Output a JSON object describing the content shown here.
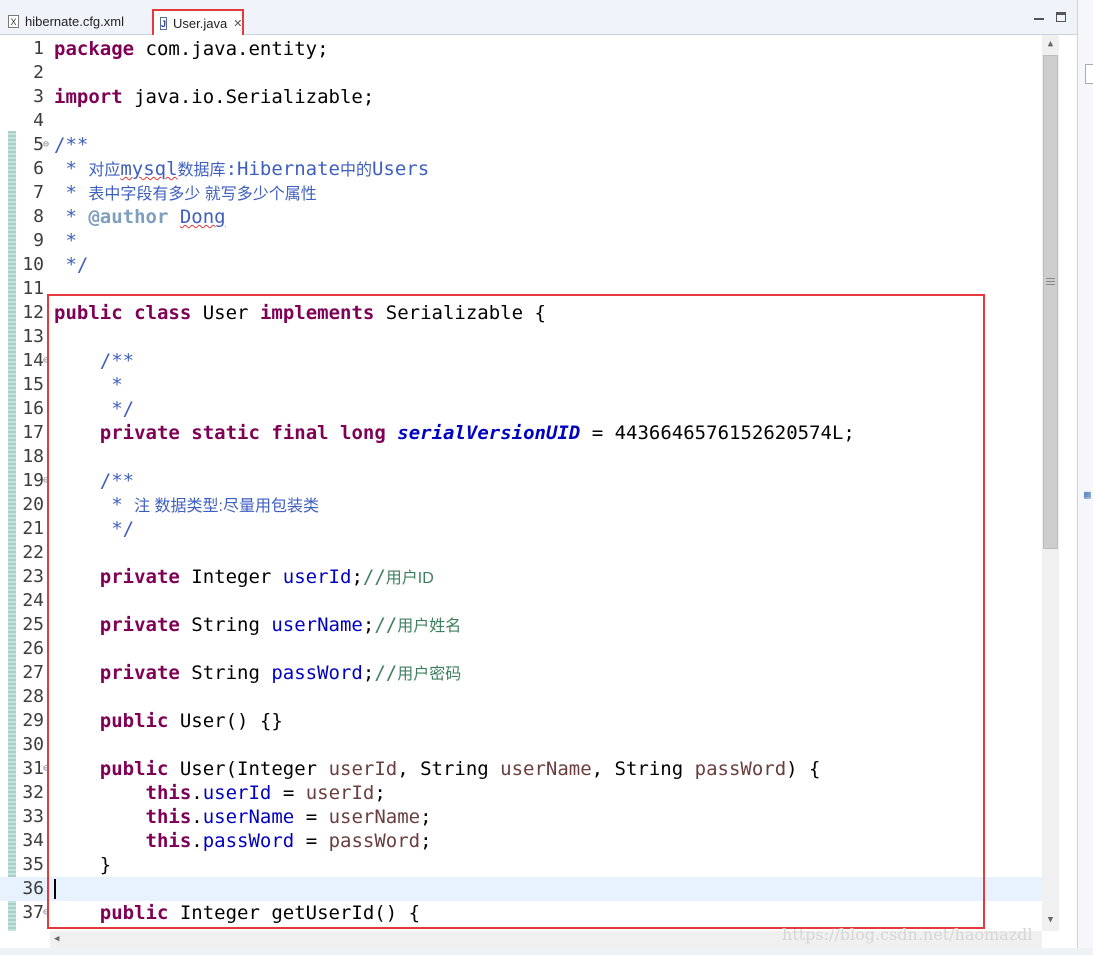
{
  "tabs": [
    {
      "label": "hibernate.cfg.xml",
      "icon": "xml-file-icon",
      "icon_glyph": "X",
      "active": false
    },
    {
      "label": "User.java",
      "icon": "java-file-icon",
      "icon_glyph": "J",
      "active": true,
      "close": "✕"
    }
  ],
  "colors": {
    "highlight_box": "#e5393b",
    "keyword": "#7f0055",
    "comment": "#3f5fbf",
    "field": "#0000c0",
    "line_comment": "#3f7f5f"
  },
  "code": {
    "l1": {
      "n": "1",
      "kw": "package",
      "rest": " com.java.entity;"
    },
    "l2": {
      "n": "2"
    },
    "l3": {
      "n": "3",
      "kw": "import",
      "rest": " java.io.Serializable;"
    },
    "l4": {
      "n": "4"
    },
    "l5": {
      "n": "5",
      "text": "/**"
    },
    "l6": {
      "n": "6",
      "a": " * ",
      "b": "对应",
      "c": "mysql",
      "d": "数据库",
      "e": ":Hibernate",
      "f": "中的",
      "g": "Users"
    },
    "l7": {
      "n": "7",
      "a": " * ",
      "b": "表中字段有多少 就写多少个属性"
    },
    "l8": {
      "n": "8",
      "a": " * ",
      "tag": "@author",
      "sp": " ",
      "name": "Dong"
    },
    "l9": {
      "n": "9",
      "text": " *"
    },
    "l10": {
      "n": "10",
      "text": " */"
    },
    "l11": {
      "n": "11"
    },
    "l12": {
      "n": "12",
      "k1": "public",
      "k2": "class",
      "m": " User ",
      "k3": "implements",
      "rest": " Serializable {"
    },
    "l13": {
      "n": "13"
    },
    "l14": {
      "n": "14",
      "text": "    /**"
    },
    "l15": {
      "n": "15",
      "text": "     *"
    },
    "l16": {
      "n": "16",
      "text": "     */"
    },
    "l17": {
      "n": "17",
      "k1": "private",
      "k2": "static",
      "k3": "final",
      "k4": "long",
      "f": "serialVersionUID",
      "rest": " = 4436646576152620574L;"
    },
    "l18": {
      "n": "18"
    },
    "l19": {
      "n": "19",
      "text": "    /**"
    },
    "l20": {
      "n": "20",
      "a": "     * ",
      "b": "注 数据类型:尽量用包装类"
    },
    "l21": {
      "n": "21",
      "text": "     */"
    },
    "l22": {
      "n": "22"
    },
    "l23": {
      "n": "23",
      "kw": "private",
      "type": " Integer ",
      "f": "userId",
      "semi": ";",
      "lc": "//",
      "lcn": "用户ID"
    },
    "l24": {
      "n": "24"
    },
    "l25": {
      "n": "25",
      "kw": "private",
      "type": " String ",
      "f": "userName",
      "semi": ";",
      "lc": "//",
      "lcn": "用户姓名"
    },
    "l26": {
      "n": "26"
    },
    "l27": {
      "n": "27",
      "kw": "private",
      "type": " String ",
      "f": "passWord",
      "semi": ";",
      "lc": "//",
      "lcn": "用户密码"
    },
    "l28": {
      "n": "28"
    },
    "l29": {
      "n": "29",
      "kw": "public",
      "rest": " User() {}"
    },
    "l30": {
      "n": "30"
    },
    "l31": {
      "n": "31",
      "kw": "public",
      "t1": " User(Integer ",
      "p1": "userId",
      "t2": ", String ",
      "p2": "userName",
      "t3": ", String ",
      "p3": "passWord",
      "t4": ") {"
    },
    "l32": {
      "n": "32",
      "kw": "this",
      "dot": ".",
      "f": "userId",
      "eq": " = ",
      "p": "userId",
      "semi": ";"
    },
    "l33": {
      "n": "33",
      "kw": "this",
      "dot": ".",
      "f": "userName",
      "eq": " = ",
      "p": "userName",
      "semi": ";"
    },
    "l34": {
      "n": "34",
      "kw": "this",
      "dot": ".",
      "f": "passWord",
      "eq": " = ",
      "p": "passWord",
      "semi": ";"
    },
    "l35": {
      "n": "35",
      "text": "    }"
    },
    "l36": {
      "n": "36"
    },
    "l37": {
      "n": "37",
      "kw": "public",
      "rest": " Integer getUserId() {"
    }
  },
  "fold_marker": "⊖",
  "watermark": "https://blog.csdn.net/haomazdl"
}
